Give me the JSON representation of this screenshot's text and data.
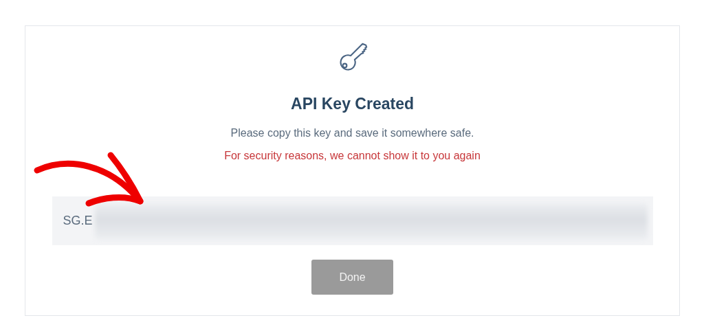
{
  "dialog": {
    "title": "API Key Created",
    "message": "Please copy this key and save it somewhere safe.",
    "warning": "For security reasons, we cannot show it to you again",
    "api_key": {
      "value": "SG.E",
      "redacted": true
    },
    "buttons": [
      {
        "label": "Done",
        "disabled": true
      }
    ]
  }
}
